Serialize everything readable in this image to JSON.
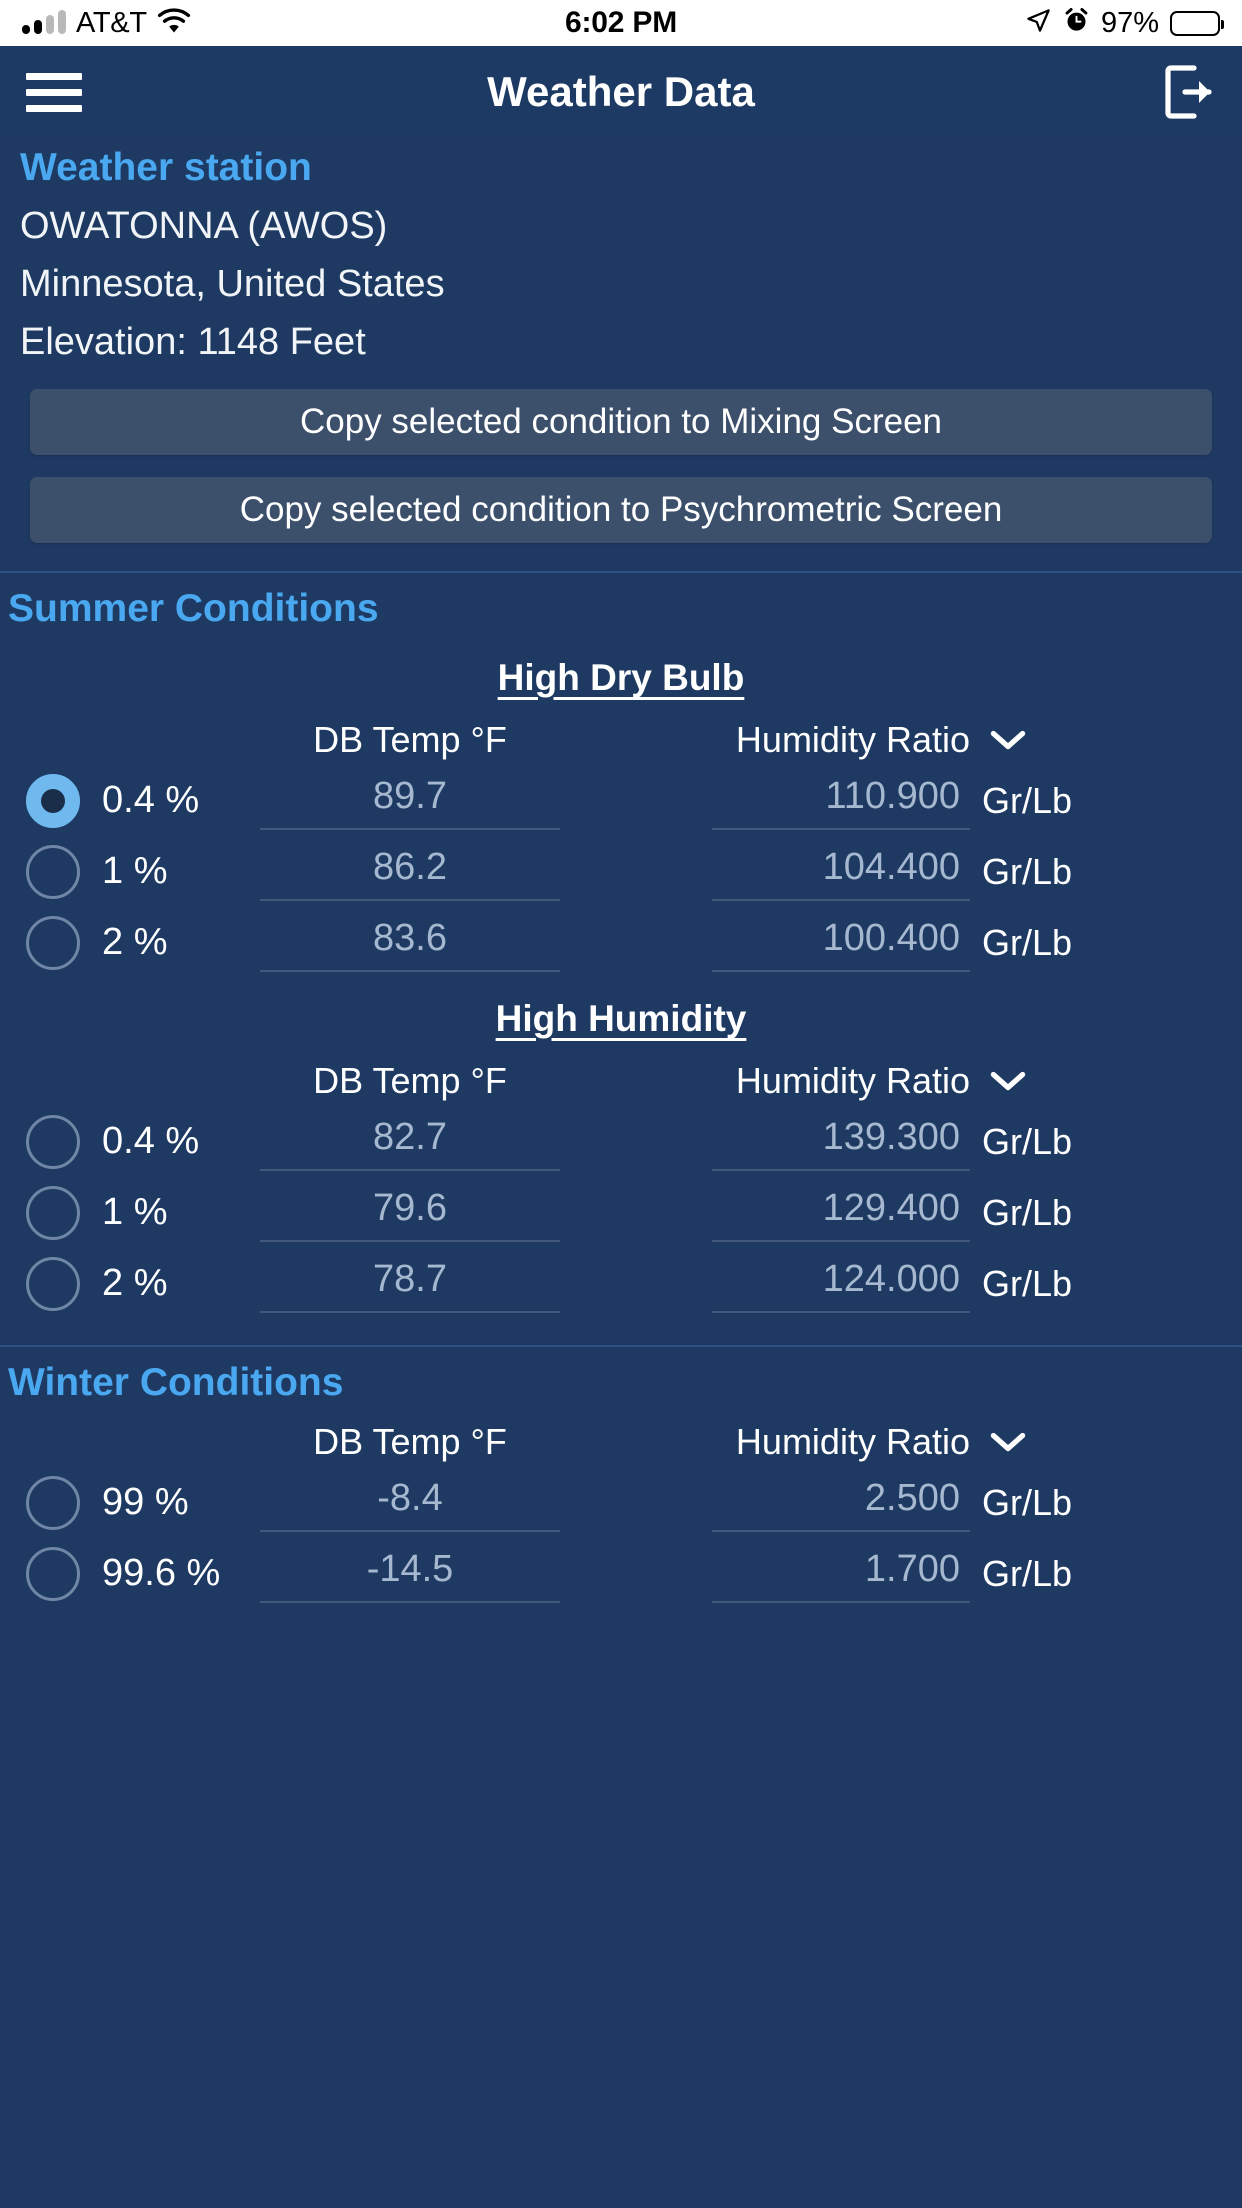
{
  "status_bar": {
    "carrier": "AT&T",
    "time": "6:02 PM",
    "battery_percent": "97%",
    "icons": [
      "signal-bars-icon",
      "wifi-icon",
      "location-arrow-icon",
      "alarm-clock-icon",
      "battery-icon"
    ]
  },
  "navbar": {
    "title": "Weather Data",
    "menu_icon": "hamburger-menu-icon",
    "logout_icon": "logout-icon"
  },
  "station": {
    "heading": "Weather station",
    "name": "OWATONNA (AWOS)",
    "location": "Minnesota, United States",
    "elevation": "Elevation: 1148 Feet"
  },
  "actions": {
    "copy_mixing": "Copy selected condition to Mixing Screen",
    "copy_psychrometric": "Copy selected condition to Psychrometric Screen"
  },
  "columns": {
    "db_temp": "DB Temp °F",
    "humidity_ratio": "Humidity Ratio",
    "unit": "Gr/Lb",
    "dropdown_icon": "chevron-down-icon"
  },
  "summer": {
    "title": "Summer Conditions",
    "tables": [
      {
        "subtitle": "High Dry Bulb",
        "rows": [
          {
            "percent": "0.4 %",
            "db_temp": "89.7",
            "humidity_ratio": "110.900",
            "unit": "Gr/Lb",
            "selected": true
          },
          {
            "percent": "1 %",
            "db_temp": "86.2",
            "humidity_ratio": "104.400",
            "unit": "Gr/Lb",
            "selected": false
          },
          {
            "percent": "2 %",
            "db_temp": "83.6",
            "humidity_ratio": "100.400",
            "unit": "Gr/Lb",
            "selected": false
          }
        ]
      },
      {
        "subtitle": "High Humidity",
        "rows": [
          {
            "percent": "0.4 %",
            "db_temp": "82.7",
            "humidity_ratio": "139.300",
            "unit": "Gr/Lb",
            "selected": false
          },
          {
            "percent": "1 %",
            "db_temp": "79.6",
            "humidity_ratio": "129.400",
            "unit": "Gr/Lb",
            "selected": false
          },
          {
            "percent": "2 %",
            "db_temp": "78.7",
            "humidity_ratio": "124.000",
            "unit": "Gr/Lb",
            "selected": false
          }
        ]
      }
    ]
  },
  "winter": {
    "title": "Winter Conditions",
    "tables": [
      {
        "subtitle": "",
        "rows": [
          {
            "percent": "99 %",
            "db_temp": "-8.4",
            "humidity_ratio": "2.500",
            "unit": "Gr/Lb",
            "selected": false
          },
          {
            "percent": "99.6 %",
            "db_temp": "-14.5",
            "humidity_ratio": "1.700",
            "unit": "Gr/Lb",
            "selected": false
          }
        ]
      }
    ]
  },
  "colors": {
    "background": "#1e3a63",
    "accent": "#4aa8f0",
    "button": "#3c506c",
    "value_text": "#a6b8cf",
    "radio_selected": "#6fb9ef"
  }
}
